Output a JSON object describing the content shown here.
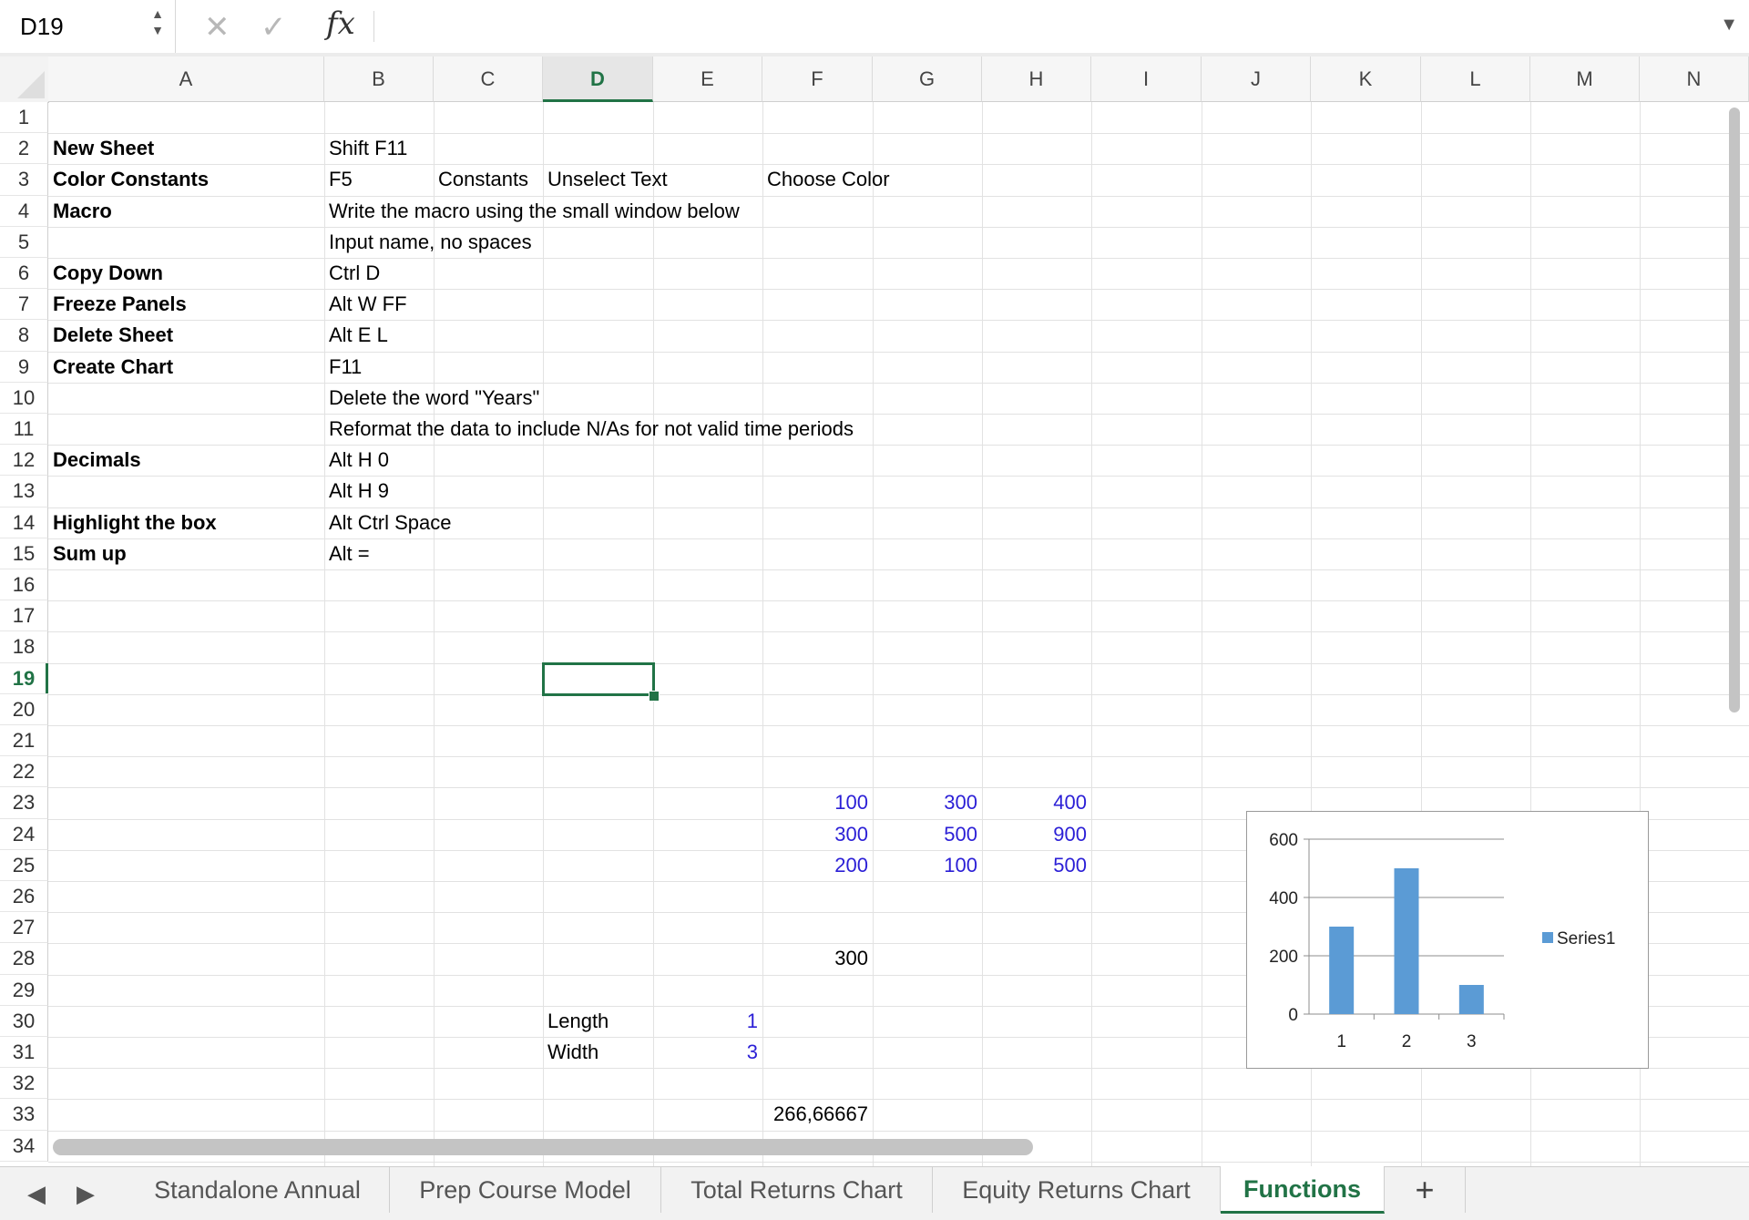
{
  "formula_bar": {
    "name_box": "D19",
    "cancel_icon": "cancel-icon",
    "enter_icon": "check-icon",
    "fx_label": "fx",
    "formula_value": ""
  },
  "columns": [
    "A",
    "B",
    "C",
    "D",
    "E",
    "F",
    "G",
    "H",
    "I",
    "J",
    "K",
    "L",
    "M",
    "N"
  ],
  "active_column": "D",
  "rows": [
    "1",
    "2",
    "3",
    "4",
    "5",
    "6",
    "7",
    "8",
    "9",
    "10",
    "11",
    "12",
    "13",
    "14",
    "15",
    "16",
    "17",
    "18",
    "19",
    "20",
    "21",
    "22",
    "23",
    "24",
    "25",
    "26",
    "27",
    "28",
    "29",
    "30",
    "31",
    "32",
    "33",
    "34"
  ],
  "active_row": "19",
  "cells": {
    "A2": "New Sheet",
    "B2": "Shift F11",
    "A3": "Color Constants",
    "B3": "F5",
    "C3": "Constants",
    "D3": "Unselect Text",
    "F3": "Choose Color",
    "A4": "Macro",
    "B4": "Write the macro using the small window below",
    "B5": "Input name, no spaces",
    "A6": "Copy Down",
    "B6": "Ctrl D",
    "A7": "Freeze Panels",
    "B7": "Alt W FF",
    "A8": "Delete Sheet",
    "B8": "Alt E L",
    "A9": "Create Chart",
    "B9": "F11",
    "B10": "Delete the word \"Years\"",
    "B11": "Reformat the data to include N/As for not valid time periods",
    "A12": "Decimals",
    "B12": "Alt H 0",
    "B13": "Alt H 9",
    "A14": "Highlight the box",
    "B14": "Alt Ctrl Space",
    "A15": "Sum up",
    "B15": "Alt =",
    "F23": "100",
    "G23": "300",
    "H23": "400",
    "F24": "300",
    "G24": "500",
    "H24": "900",
    "F25": "200",
    "G25": "100",
    "H25": "500",
    "F28": "300",
    "D30": "Length",
    "E30": "1",
    "D31": "Width",
    "E31": "3",
    "F33": "266,66667"
  },
  "sheet_tabs": [
    {
      "label": "Standalone Annual",
      "active": false
    },
    {
      "label": "Prep Course Model",
      "active": false
    },
    {
      "label": "Total Returns Chart",
      "active": false
    },
    {
      "label": "Equity Returns Chart",
      "active": false
    },
    {
      "label": "Functions",
      "active": true
    }
  ],
  "add_sheet_label": "+",
  "colors": {
    "accent": "#217346",
    "bar": "#5b9bd5",
    "number": "#2b1fd6"
  },
  "chart_data": {
    "type": "bar",
    "categories": [
      "1",
      "2",
      "3"
    ],
    "series": [
      {
        "name": "Series1",
        "values": [
          300,
          500,
          100
        ]
      }
    ],
    "ylim": [
      0,
      600
    ],
    "yticks": [
      "0",
      "200",
      "400",
      "600"
    ],
    "grid": true,
    "legend": "right"
  }
}
